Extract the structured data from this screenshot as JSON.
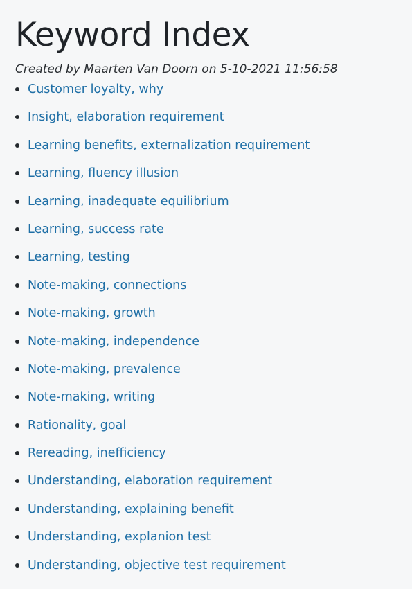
{
  "page": {
    "title": "Keyword Index",
    "meta": "Created by Maarten Van Doorn on 5-10-2021 11:56:58"
  },
  "keywords": [
    {
      "label": "Customer loyalty, why"
    },
    {
      "label": "Insight, elaboration requirement"
    },
    {
      "label": "Learning benefits, externalization requirement"
    },
    {
      "label": "Learning, fluency illusion"
    },
    {
      "label": "Learning, inadequate equilibrium"
    },
    {
      "label": "Learning, success rate"
    },
    {
      "label": "Learning, testing"
    },
    {
      "label": "Note-making, connections"
    },
    {
      "label": "Note-making, growth"
    },
    {
      "label": "Note-making, independence"
    },
    {
      "label": "Note-making, prevalence"
    },
    {
      "label": "Note-making, writing"
    },
    {
      "label": "Rationality, goal"
    },
    {
      "label": "Rereading, inefficiency"
    },
    {
      "label": "Understanding, elaboration requirement"
    },
    {
      "label": "Understanding, explaining benefit"
    },
    {
      "label": "Understanding, explanion test"
    },
    {
      "label": "Understanding, objective test requirement"
    }
  ],
  "colors": {
    "link": "#1f6fa6",
    "text": "#24292e",
    "background": "#f6f7f8"
  }
}
